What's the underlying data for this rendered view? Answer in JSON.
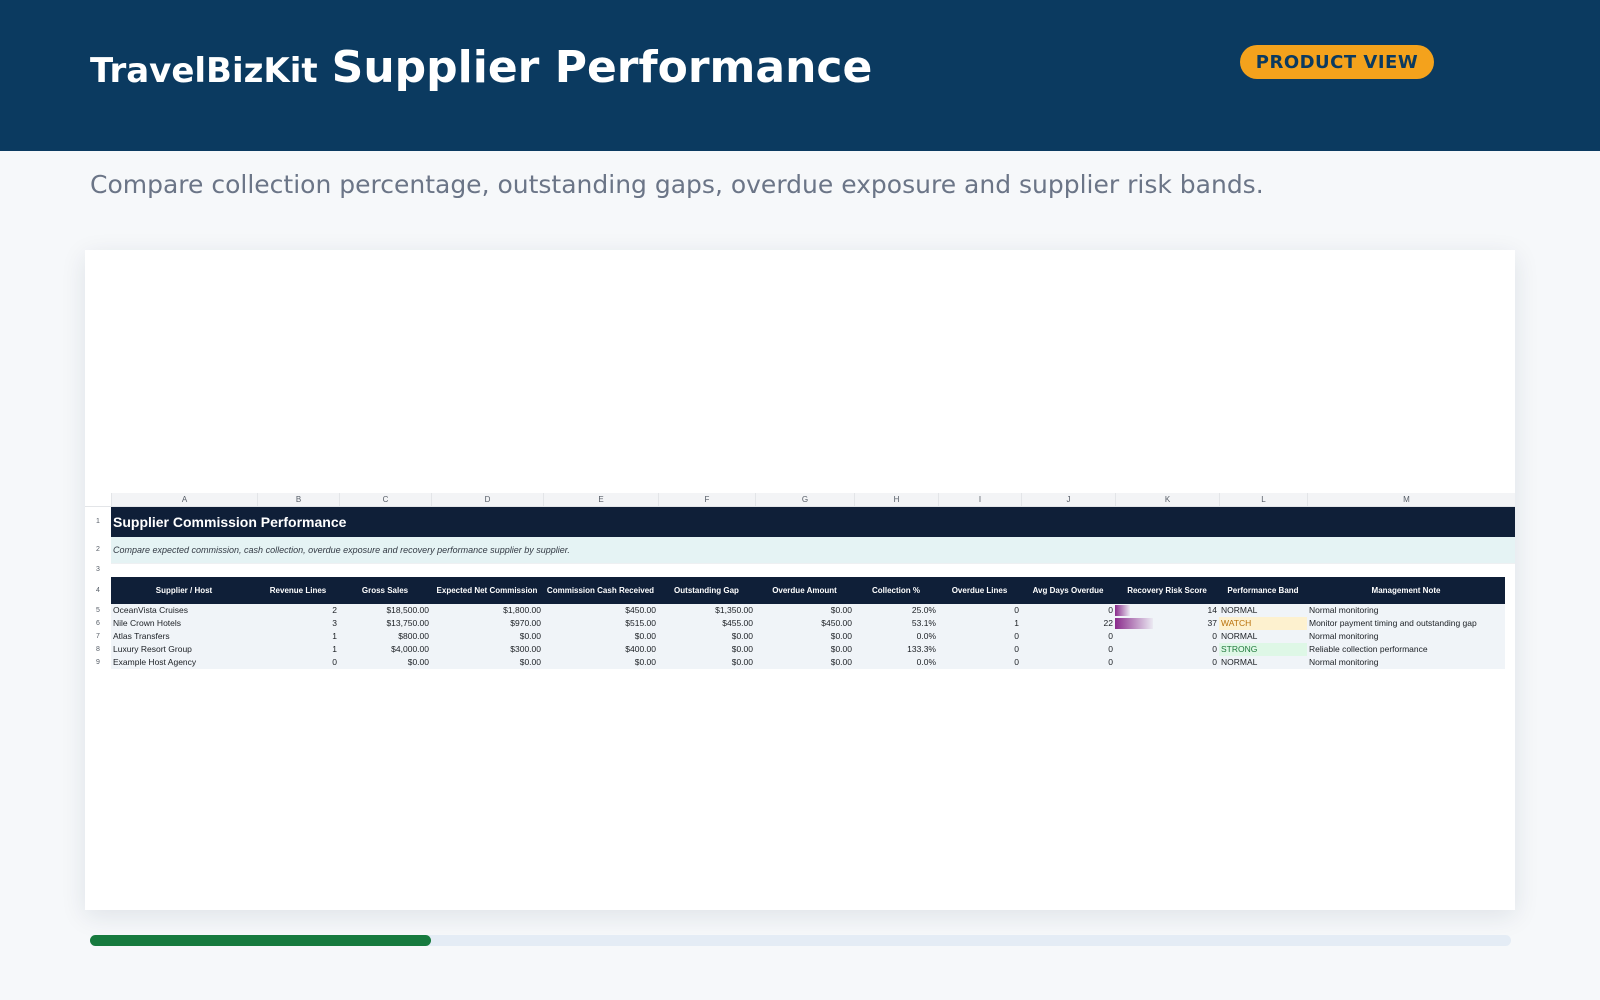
{
  "header": {
    "brand": "TravelBizKit",
    "title": "Supplier Performance",
    "badge": "PRODUCT VIEW",
    "subtitle": "Compare collection percentage, outstanding gaps, overdue exposure and supplier risk bands."
  },
  "colors": {
    "header_bg": "#0b3a60",
    "badge_bg": "#f4a21c",
    "table_header_bg": "#0f1f38",
    "progress_fill": "#167a3e",
    "risk_bar": "#8a2b8c"
  },
  "sheet": {
    "column_letters": [
      "A",
      "B",
      "C",
      "D",
      "E",
      "F",
      "G",
      "H",
      "I",
      "J",
      "K",
      "L",
      "M"
    ],
    "row_numbers": [
      "1",
      "2",
      "3",
      "4",
      "5",
      "6",
      "7",
      "8",
      "9"
    ],
    "title": "Supplier Commission Performance",
    "description": "Compare expected commission, cash collection, overdue exposure and recovery performance supplier by supplier.",
    "headers": [
      "Supplier / Host",
      "Revenue Lines",
      "Gross Sales",
      "Expected Net Commission",
      "Commission Cash Received",
      "Outstanding Gap",
      "Overdue Amount",
      "Collection %",
      "Overdue Lines",
      "Avg Days Overdue",
      "Recovery Risk Score",
      "Performance Band",
      "Management Note"
    ],
    "rows": [
      {
        "supplier": "OceanVista Cruises",
        "revenue_lines": "2",
        "gross_sales": "$18,500.00",
        "expected_commission": "$1,800.00",
        "cash_received": "$450.00",
        "outstanding_gap": "$1,350.00",
        "overdue_amount": "$0.00",
        "collection_pct": "25.0%",
        "overdue_lines": "0",
        "avg_days_overdue": "0",
        "risk_score": "14",
        "band": "NORMAL",
        "note": "Normal monitoring"
      },
      {
        "supplier": "Nile Crown Hotels",
        "revenue_lines": "3",
        "gross_sales": "$13,750.00",
        "expected_commission": "$970.00",
        "cash_received": "$515.00",
        "outstanding_gap": "$455.00",
        "overdue_amount": "$450.00",
        "collection_pct": "53.1%",
        "overdue_lines": "1",
        "avg_days_overdue": "22",
        "risk_score": "37",
        "band": "WATCH",
        "note": "Monitor payment timing and outstanding gap"
      },
      {
        "supplier": "Atlas Transfers",
        "revenue_lines": "1",
        "gross_sales": "$800.00",
        "expected_commission": "$0.00",
        "cash_received": "$0.00",
        "outstanding_gap": "$0.00",
        "overdue_amount": "$0.00",
        "collection_pct": "0.0%",
        "overdue_lines": "0",
        "avg_days_overdue": "0",
        "risk_score": "0",
        "band": "NORMAL",
        "note": "Normal monitoring"
      },
      {
        "supplier": "Luxury Resort Group",
        "revenue_lines": "1",
        "gross_sales": "$4,000.00",
        "expected_commission": "$300.00",
        "cash_received": "$400.00",
        "outstanding_gap": "$0.00",
        "overdue_amount": "$0.00",
        "collection_pct": "133.3%",
        "overdue_lines": "0",
        "avg_days_overdue": "0",
        "risk_score": "0",
        "band": "STRONG",
        "note": "Reliable collection performance"
      },
      {
        "supplier": "Example Host Agency",
        "revenue_lines": "0",
        "gross_sales": "$0.00",
        "expected_commission": "$0.00",
        "cash_received": "$0.00",
        "outstanding_gap": "$0.00",
        "overdue_amount": "$0.00",
        "collection_pct": "0.0%",
        "overdue_lines": "0",
        "avg_days_overdue": "0",
        "risk_score": "0",
        "band": "NORMAL",
        "note": "Normal monitoring"
      }
    ]
  },
  "progress": {
    "value": 0.24
  }
}
